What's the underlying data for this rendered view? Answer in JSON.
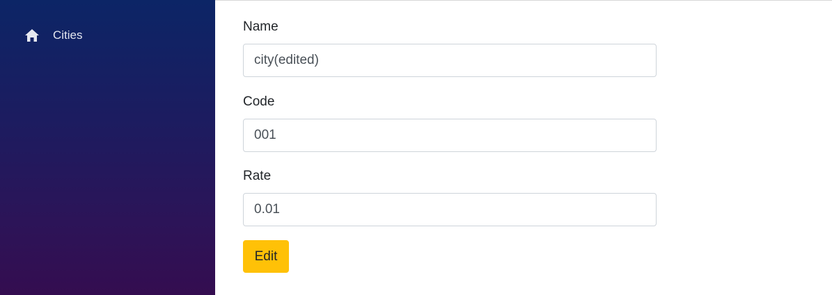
{
  "sidebar": {
    "items": [
      {
        "label": "Cities",
        "icon": "home-icon"
      }
    ]
  },
  "form": {
    "name_label": "Name",
    "name_value": "city(edited)",
    "code_label": "Code",
    "code_value": "001",
    "rate_label": "Rate",
    "rate_value": "0.01",
    "edit_button_label": "Edit"
  },
  "colors": {
    "sidebar_top": "#0c2566",
    "sidebar_bottom": "#340d50",
    "edit_button": "#ffc107",
    "input_border": "#ced4da"
  }
}
